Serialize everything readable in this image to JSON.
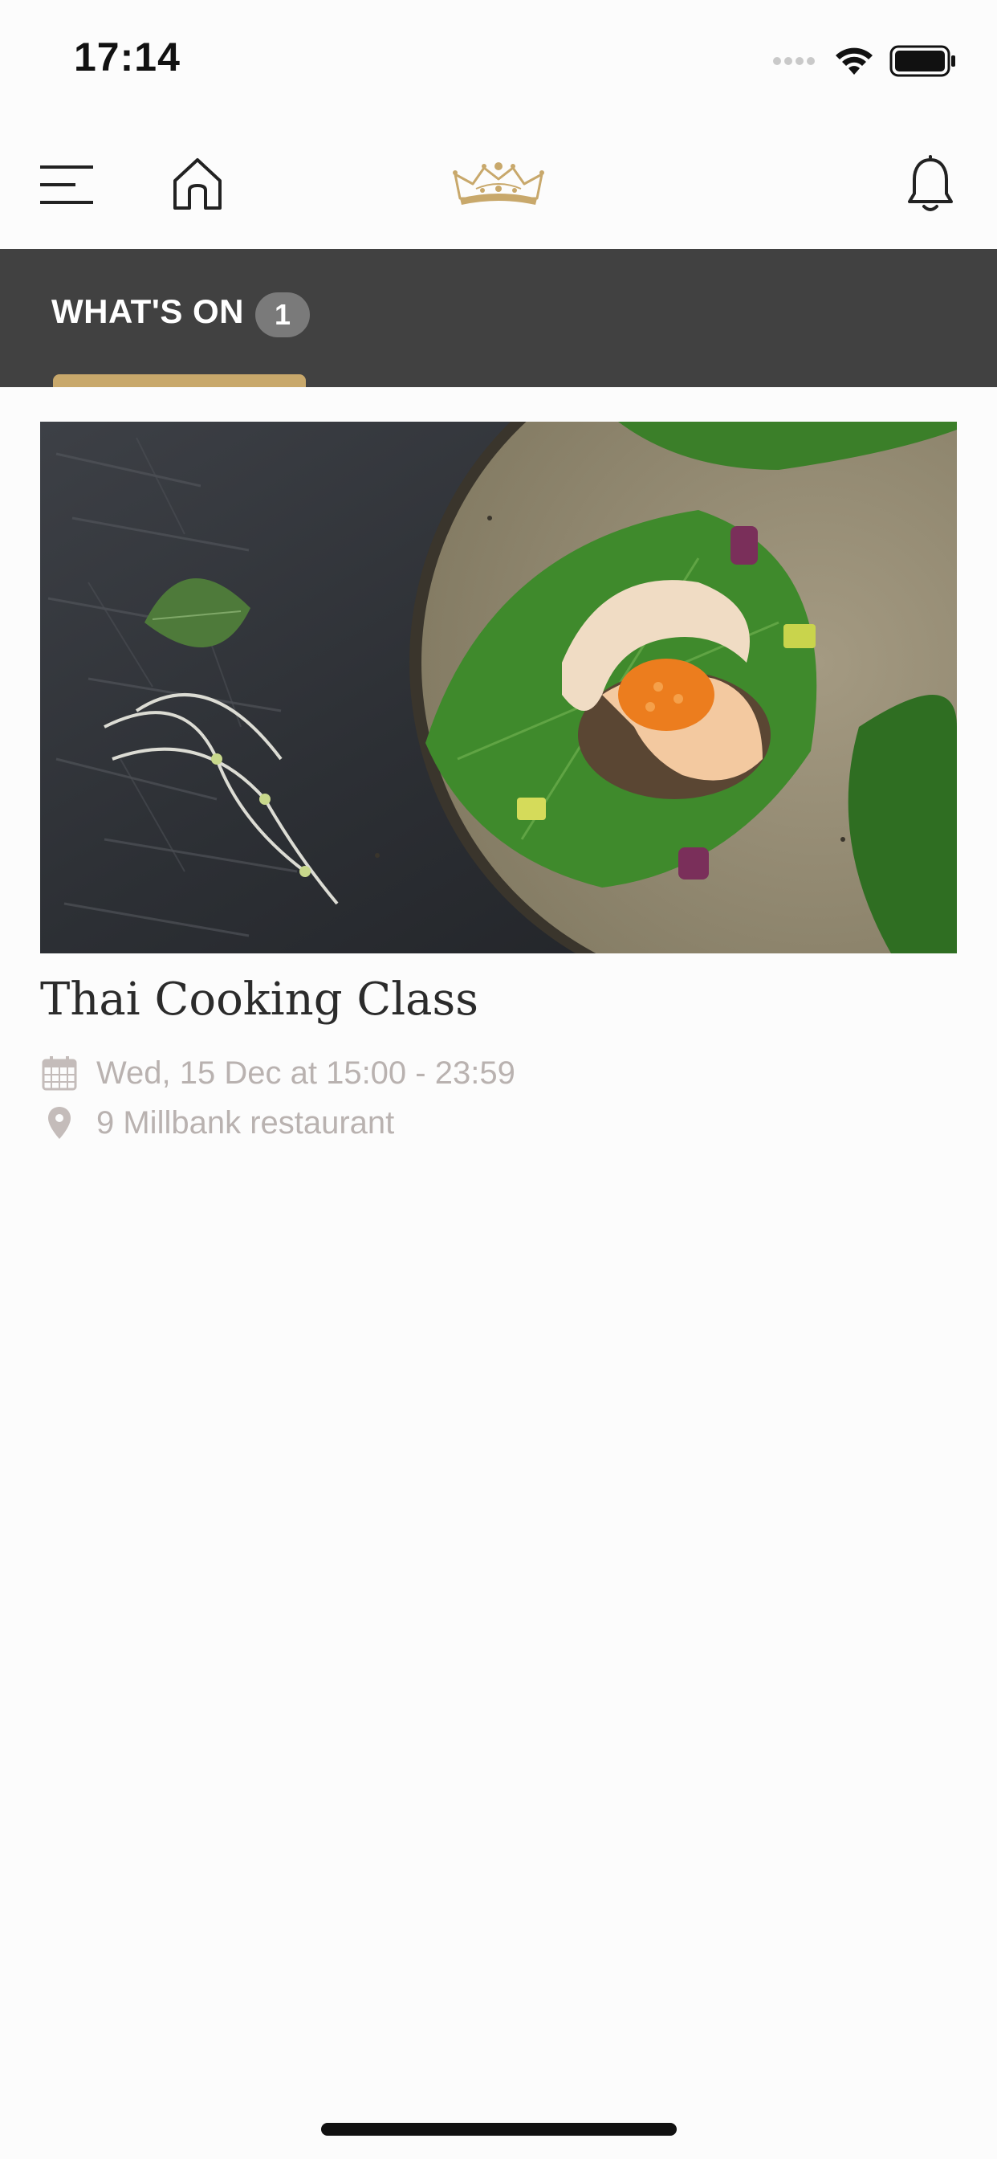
{
  "status_bar": {
    "time": "17:14"
  },
  "nav": {
    "menu_icon": "menu-icon",
    "home_icon": "home-icon",
    "logo_icon": "crown-logo",
    "notifications_icon": "bell-icon"
  },
  "tabs": [
    {
      "label": "WHAT'S ON",
      "badge": "1",
      "active": true
    }
  ],
  "colors": {
    "accent": "#c8a86b",
    "tab_bar": "#414141",
    "badge": "#7a7a7a",
    "meta_text": "#b9b2b0"
  },
  "event": {
    "title": "Thai Cooking Class",
    "date": "Wed, 15 Dec at 15:00 - 23:59",
    "location": "9 Millbank restaurant",
    "date_icon": "calendar-icon",
    "location_icon": "location-pin-icon"
  }
}
